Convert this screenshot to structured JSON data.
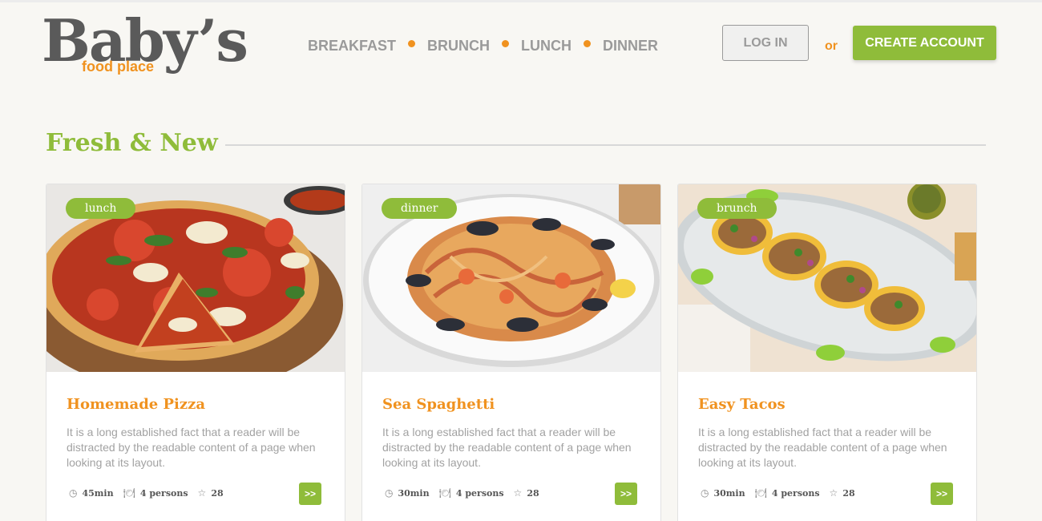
{
  "logo": {
    "main": "Baby’s",
    "sub": "food place"
  },
  "nav": {
    "items": [
      "BREAKFAST",
      "BRUNCH",
      "LUNCH",
      "DINNER"
    ]
  },
  "auth": {
    "login_label": "LOG IN",
    "or_label": "or",
    "create_label": "CREATE ACCOUNT"
  },
  "section": {
    "title": "Fresh & New"
  },
  "colors": {
    "accent_green": "#8fbc3a",
    "accent_orange": "#f0921f",
    "text_gray": "#9a9a9a",
    "background": "#f8f7f3"
  },
  "cards": [
    {
      "tag": "lunch",
      "title": "Homemade Pizza",
      "description": "It is a long established fact that a reader will be distracted by the readable content of a page when looking at its layout.",
      "time": "45min",
      "persons": "4 persons",
      "rating": "28",
      "more_label": ">>",
      "image": "pizza-photo"
    },
    {
      "tag": "dinner",
      "title": "Sea Spaghetti",
      "description": "It is a long established fact that a reader will be distracted by the readable content of a page when looking at its layout.",
      "time": "30min",
      "persons": "4 persons",
      "rating": "28",
      "more_label": ">>",
      "image": "spaghetti-photo"
    },
    {
      "tag": "brunch",
      "title": "Easy Tacos",
      "description": "It is a long established fact that a reader will be distracted by the readable content of a page when looking at its layout.",
      "time": "30min",
      "persons": "4 persons",
      "rating": "28",
      "more_label": ">>",
      "image": "tacos-photo"
    }
  ],
  "icons": {
    "time": "clock-icon",
    "persons": "utensils-icon",
    "rating": "star-icon"
  }
}
